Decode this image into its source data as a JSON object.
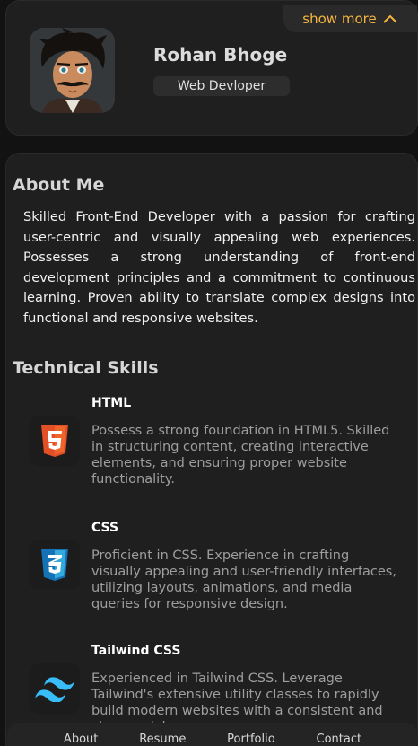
{
  "profile": {
    "show_more_label": "show more",
    "name": "Rohan Bhoge",
    "title": "Web Devloper"
  },
  "about": {
    "heading": "About Me",
    "text": "Skilled Front-End Developer with a passion for crafting user-centric and visually appealing web experiences. Possesses a strong understanding of front-end development principles and a commitment to continuous learning. Proven ability to translate complex designs into functional and responsive websites."
  },
  "skills": {
    "heading": "Technical Skills",
    "items": [
      {
        "name": "HTML",
        "icon": "html5-icon",
        "description": "Possess a strong foundation in HTML5. Skilled in structuring content, creating interactive elements, and ensuring proper website functionality."
      },
      {
        "name": "CSS",
        "icon": "css3-icon",
        "description": "Proficient in CSS. Experience in crafting visually appealing and user-friendly interfaces, utilizing layouts, animations, and media queries for responsive design."
      },
      {
        "name": "Tailwind CSS",
        "icon": "tailwind-icon",
        "description": "Experienced in Tailwind CSS. Leverage Tailwind's extensive utility classes to rapidly build modern websites with a consistent and clean codebase."
      }
    ]
  },
  "nav": {
    "items": [
      "About",
      "Resume",
      "Portfolio",
      "Contact"
    ]
  },
  "colors": {
    "accent": "#f5b53f",
    "background": "#121212",
    "card": "#1f1f1f"
  }
}
